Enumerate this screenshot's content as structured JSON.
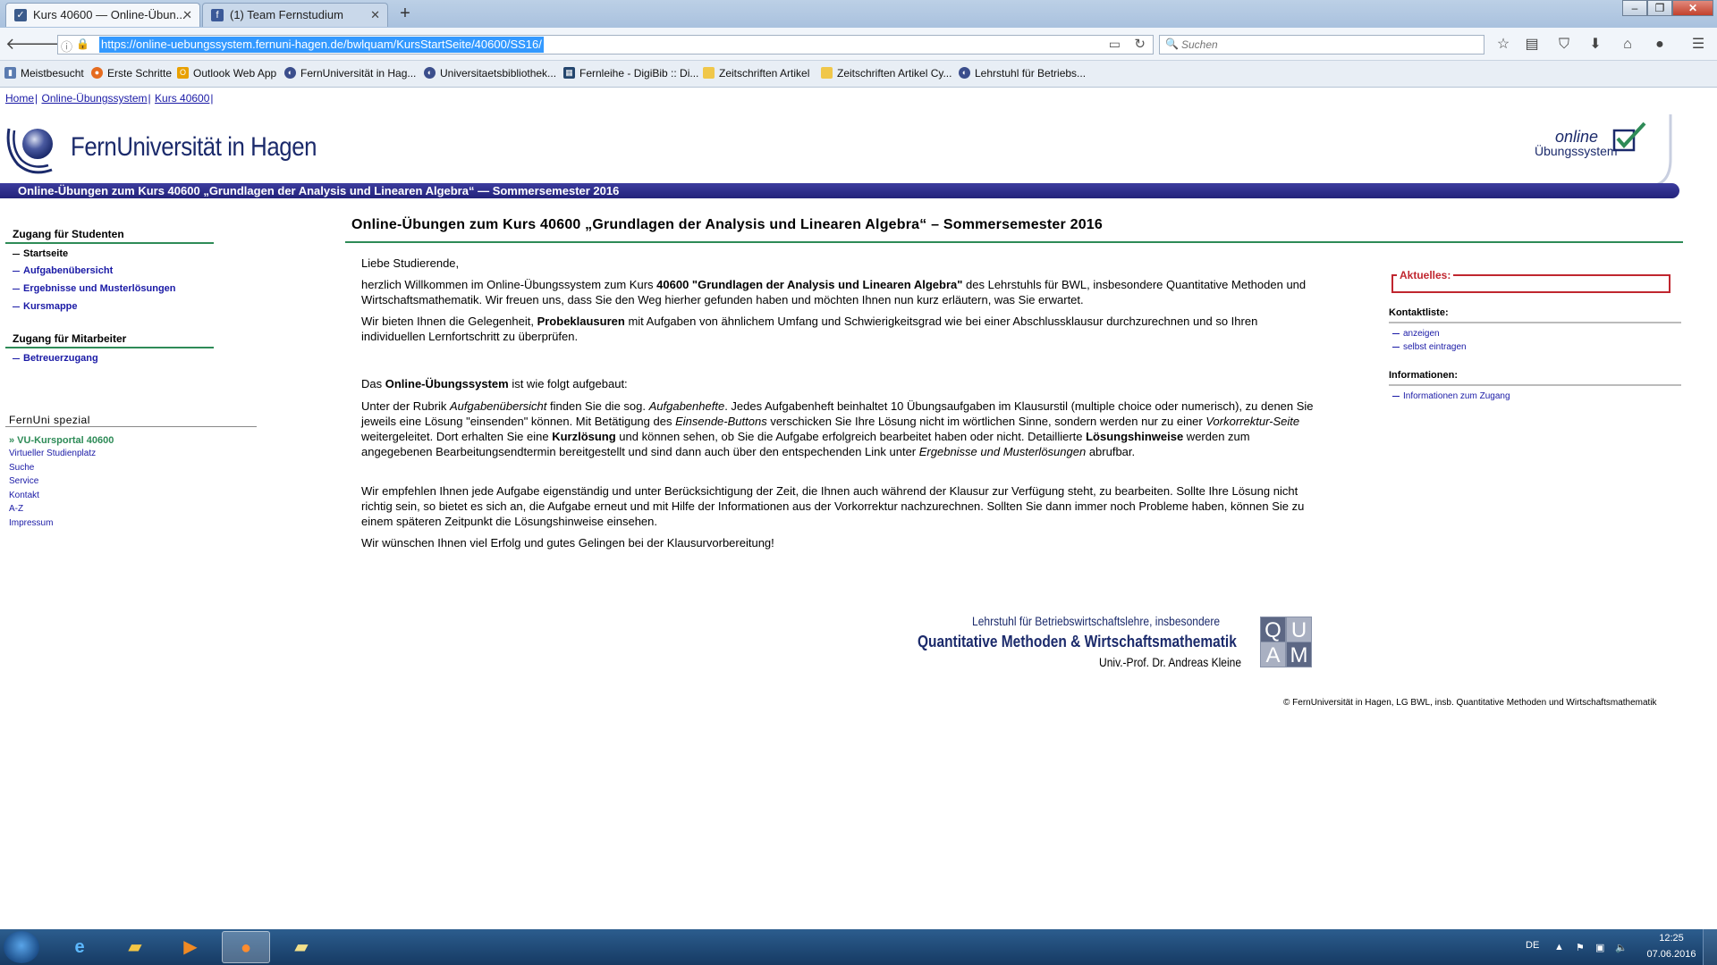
{
  "browser": {
    "tabs": [
      {
        "label": "Kurs 40600 — Online-Übun...",
        "active": true
      },
      {
        "label": "(1) Team Fernstudium",
        "active": false
      }
    ],
    "new_tab": "+",
    "url": "https://online-uebungssystem.fernuni-hagen.de/bwlquam/KursStartSeite/40600/SS16/",
    "search_placeholder": "Suchen",
    "bookmarks": [
      "Meistbesucht",
      "Erste Schritte",
      "Outlook Web App",
      "FernUniversität in Hag...",
      "Universitaetsbibliothek...",
      "Fernleihe - DigiBib :: Di...",
      "Zeitschriften Artikel",
      "Zeitschriften Artikel Cy...",
      "Lehrstuhl für Betriebs..."
    ]
  },
  "page": {
    "breadcrumb": [
      "Home",
      "Online-Übungssystem",
      "Kurs 40600"
    ],
    "logo_text": "FernUniversität in Hagen",
    "ous_logo": {
      "line1": "online",
      "line2": "Übungssystem"
    },
    "banner": "Online-Übungen zum Kurs 40600 „Grundlagen der Analysis und Linearen Algebra“ — Sommersemester 2016",
    "left_nav": {
      "students_heading": "Zugang für Studenten",
      "students_items": [
        "Startseite",
        "Aufgabenübersicht",
        "Ergebnisse und Musterlösungen",
        "Kursmappe"
      ],
      "staff_heading": "Zugang für Mitarbeiter",
      "staff_items": [
        "Betreuerzugang"
      ],
      "spezial_heading": "FernUni spezial",
      "spezial_items": [
        "» VU-Kursportal 40600",
        "Virtueller Studienplatz",
        "Suche",
        "Service",
        "Kontakt",
        "A-Z",
        "Impressum"
      ]
    },
    "main": {
      "title": "Online-Übungen zum Kurs 40600 „Grundlagen der Analysis und Linearen Algebra“ – Sommersemester 2016",
      "greeting": "Liebe Studierende,",
      "p1": {
        "a": "herzlich Willkommen im Online-Übungssystem zum Kurs ",
        "b": "40600 \"Grundlagen der Analysis und Linearen Algebra\"",
        "c": " des Lehrstuhls für BWL, insbesondere Quantitative Methoden und Wirtschaftsmathematik. Wir freuen uns, dass Sie den Weg hierher gefunden haben und möchten Ihnen nun kurz erläutern, was Sie erwartet."
      },
      "p2": {
        "a": "Wir bieten Ihnen die Gelegenheit, ",
        "b": "Probeklausuren",
        "c": " mit Aufgaben von ähnlichem Umfang und Schwierigkeitsgrad wie bei einer Abschlussklausur durchzurechnen und so Ihren individuellen Lernfortschritt zu überprüfen."
      },
      "p3": {
        "a": "Das ",
        "b": "Online-Übungssystem",
        "c": " ist wie folgt aufgebaut:"
      },
      "p4": {
        "t1": "Unter der Rubrik ",
        "i1": "Aufgabenübersicht",
        "t2": " finden Sie die sog. ",
        "i2": "Aufgabenhefte",
        "t3": ". Jedes Aufgabenheft beinhaltet 10 Übungsaufgaben im Klausurstil (multiple choice oder numerisch), zu denen Sie jeweils eine Lösung \"einsenden\" können. Mit Betätigung des ",
        "i3": "Einsende-Buttons",
        "t4": " verschicken Sie Ihre Lösung nicht im wörtlichen Sinne, sondern werden nur zu einer ",
        "i4": "Vorkorrektur-Seite",
        "t5": " weitergeleitet. Dort erhalten Sie eine ",
        "b1": "Kurzlösung",
        "t6": " und können sehen, ob Sie die Aufgabe erfolgreich bearbeitet haben oder nicht. Detaillierte ",
        "b2": "Lösungshinweise",
        "t7": " werden zum angegebenen Bearbeitungsendtermin bereitgestellt und sind dann auch über den entspechenden Link unter ",
        "i5": "Ergebnisse und Musterlösungen",
        "t8": " abrufbar."
      },
      "p5": "Wir empfehlen Ihnen jede Aufgabe eigenständig und unter Berücksichtigung der Zeit, die Ihnen auch während der Klausur zur Verfügung steht, zu bearbeiten. Sollte Ihre Lösung nicht richtig sein, so bietet es sich an, die Aufgabe erneut und mit Hilfe der Informationen aus der Vorkorrektur nachzurechnen. Sollten Sie dann immer noch Probleme haben, können Sie zu einem späteren Zeitpunkt die Lösungshinweise einsehen.",
      "p6": "Wir wünschen Ihnen viel Erfolg und gutes Gelingen bei der Klausurvorbereitung!"
    },
    "right": {
      "aktuelles": "Aktuelles:",
      "kontakt_heading": "Kontaktliste:",
      "kontakt_items": [
        "anzeigen",
        "selbst eintragen"
      ],
      "info_heading": "Informationen:",
      "info_items": [
        "Informationen zum Zugang"
      ]
    },
    "footer": {
      "line1": "Lehrstuhl für Betriebswirtschaftslehre, insbesondere",
      "line2": "Quantitative Methoden & Wirtschaftsmathematik",
      "line3": "Univ.-Prof. Dr. Andreas Kleine",
      "logo_letters": [
        "Q",
        "U",
        "A",
        "M"
      ],
      "copyright": "© FernUniversität in Hagen, LG BWL, insb. Quantitative Methoden und Wirtschaftsmathematik"
    }
  },
  "taskbar": {
    "lang": "DE",
    "time": "12:25",
    "date": "07.06.2016"
  },
  "colors": {
    "banner": "#23237a",
    "brand_blue": "#1b2a6b",
    "link": "#1a1aa6",
    "rule_green": "#2e8b57",
    "alert_red": "#c0262f"
  }
}
